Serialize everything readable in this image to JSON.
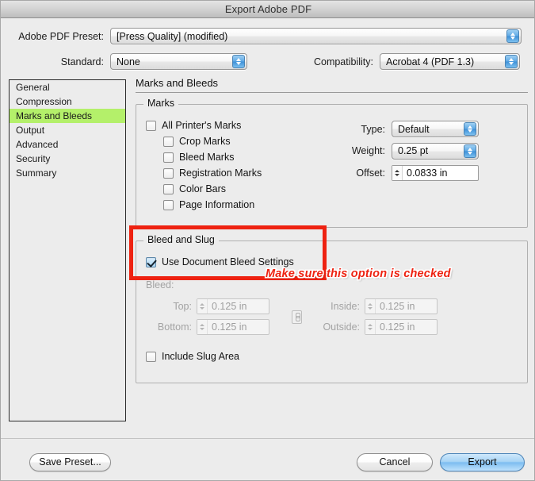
{
  "window": {
    "title": "Export Adobe PDF"
  },
  "top": {
    "preset_label": "Adobe PDF Preset:",
    "preset_value": "[Press Quality] (modified)",
    "standard_label": "Standard:",
    "standard_value": "None",
    "compatibility_label": "Compatibility:",
    "compatibility_value": "Acrobat 4 (PDF 1.3)"
  },
  "sidebar": {
    "items": [
      {
        "label": "General",
        "selected": false
      },
      {
        "label": "Compression",
        "selected": false
      },
      {
        "label": "Marks and Bleeds",
        "selected": true
      },
      {
        "label": "Output",
        "selected": false
      },
      {
        "label": "Advanced",
        "selected": false
      },
      {
        "label": "Security",
        "selected": false
      },
      {
        "label": "Summary",
        "selected": false
      }
    ],
    "selected_color": "#b4f06a"
  },
  "panel": {
    "title": "Marks and Bleeds",
    "marks": {
      "legend": "Marks",
      "checkboxes": [
        {
          "label": "All Printer's Marks",
          "checked": false
        },
        {
          "label": "Crop Marks",
          "checked": false
        },
        {
          "label": "Bleed Marks",
          "checked": false
        },
        {
          "label": "Registration Marks",
          "checked": false
        },
        {
          "label": "Color Bars",
          "checked": false
        },
        {
          "label": "Page Information",
          "checked": false
        }
      ],
      "type_label": "Type:",
      "type_value": "Default",
      "weight_label": "Weight:",
      "weight_value": "0.25 pt",
      "offset_label": "Offset:",
      "offset_value": "0.0833 in"
    },
    "bleed_slug": {
      "legend": "Bleed and Slug",
      "use_doc_bleed_label": "Use Document Bleed Settings",
      "use_doc_bleed_checked": true,
      "bleed_label": "Bleed:",
      "top_label": "Top:",
      "top_value": "0.125 in",
      "bottom_label": "Bottom:",
      "bottom_value": "0.125 in",
      "inside_label": "Inside:",
      "inside_value": "0.125 in",
      "outside_label": "Outside:",
      "outside_value": "0.125 in",
      "include_slug_label": "Include Slug Area",
      "include_slug_checked": false
    }
  },
  "footer": {
    "save_preset": "Save Preset...",
    "cancel": "Cancel",
    "export": "Export"
  },
  "annotation": {
    "text": "Make sure this option is checked",
    "color": "#ee2211"
  }
}
